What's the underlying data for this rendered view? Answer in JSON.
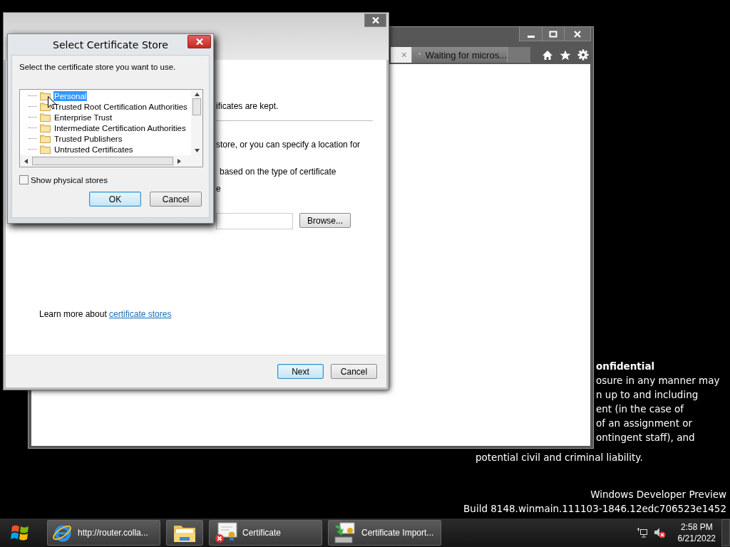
{
  "desktop": {
    "notice_title": "onfidential",
    "notice_lines": [
      "osure in any manner may",
      "n up to and including",
      "ent (in the case of",
      "of an assignment or",
      "ontingent staff), and"
    ],
    "notice_last_line": "potential civil and criminal liability.",
    "watermark": [
      "Windows Developer Preview",
      "Build 8148.winmain.111103-1846.12edc706523e1452"
    ]
  },
  "browser": {
    "tabs": [
      {
        "kind": "cut",
        "label": "×"
      },
      {
        "kind": "loading",
        "label": "Waiting for micros..."
      },
      {
        "kind": "blank"
      }
    ]
  },
  "wizard": {
    "fragments": [
      "ificates are kept.",
      "store, or you can specify a location for",
      "based on the type of certificate",
      "e"
    ],
    "browse_button": "Browse...",
    "learn_more": {
      "text": "Learn more about",
      "link": "certificate stores"
    },
    "buttons": [
      {
        "label": "Next",
        "default": true
      },
      {
        "label": "Cancel",
        "default": false
      }
    ]
  },
  "dialog": {
    "title": "Select Certificate Store",
    "prompt": "Select the certificate store you want to use.",
    "stores": [
      {
        "label": "Personal",
        "selected": true
      },
      {
        "label": "Trusted Root Certification Authorities",
        "selected": false
      },
      {
        "label": "Enterprise Trust",
        "selected": false
      },
      {
        "label": "Intermediate Certification Authorities",
        "selected": false
      },
      {
        "label": "Trusted Publishers",
        "selected": false
      },
      {
        "label": "Untrusted Certificates",
        "selected": false
      }
    ],
    "show_physical": {
      "label": "Show physical stores",
      "checked": false
    },
    "buttons": [
      {
        "label": "OK",
        "default": true
      },
      {
        "label": "Cancel",
        "default": false
      }
    ]
  },
  "taskbar": {
    "items": [
      {
        "kind": "browser",
        "label": "http://router.colla..."
      },
      {
        "kind": "folder"
      },
      {
        "kind": "certificate",
        "label": "Certificate"
      },
      {
        "kind": "import",
        "label": "Certificate Import..."
      }
    ],
    "tray": {
      "network": true,
      "muted": true,
      "time": "2:58 PM",
      "date": "6/21/2022"
    }
  }
}
